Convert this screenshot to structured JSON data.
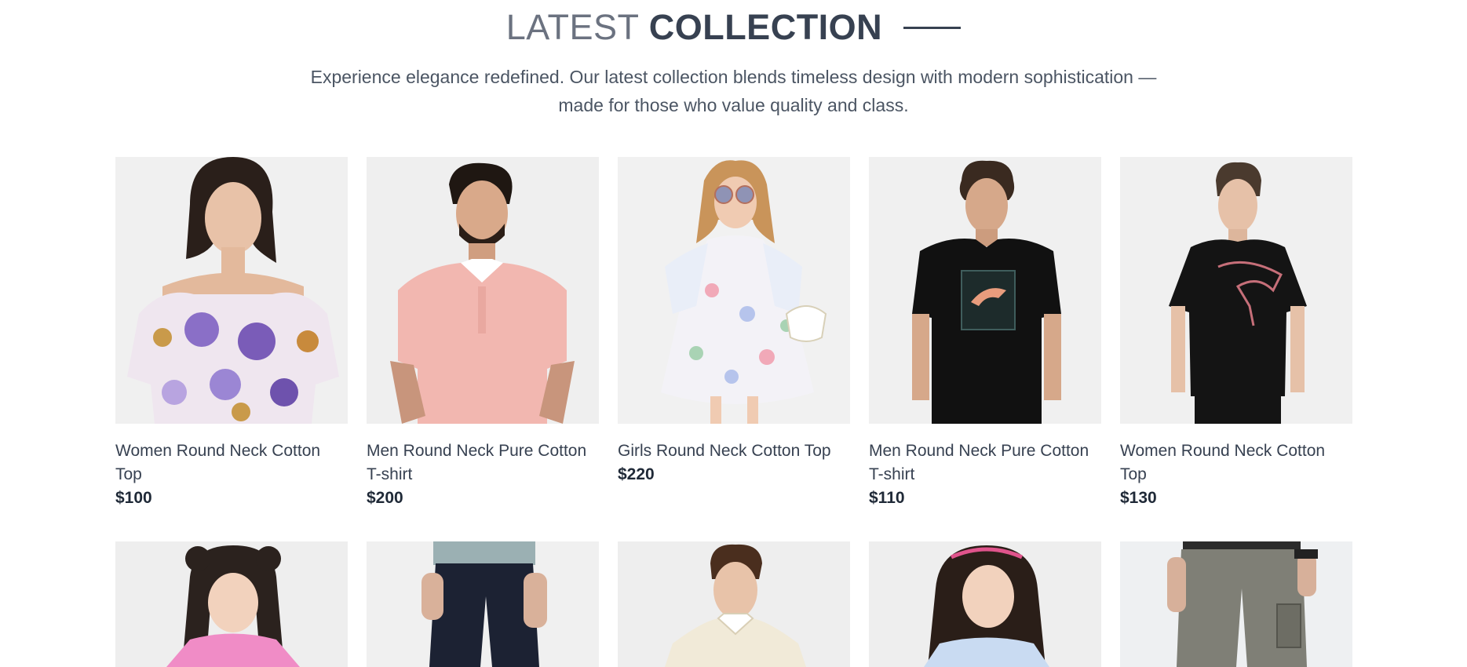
{
  "section": {
    "title_light": "LATEST",
    "title_bold": "COLLECTION",
    "subtitle_line1": "Experience elegance redefined. Our latest collection blends timeless design with modern sophistication —",
    "subtitle_line2": "made for those who value quality and class."
  },
  "products": [
    {
      "name": "Women Round Neck Cotton Top",
      "price": "$100",
      "image": "woman-floral-off-shoulder-top"
    },
    {
      "name": "Men Round Neck Pure Cotton T-shirt",
      "price": "$200",
      "image": "man-pink-polo-shirt"
    },
    {
      "name": "Girls Round Neck Cotton Top",
      "price": "$220",
      "image": "girl-floral-dress-sunglasses"
    },
    {
      "name": "Men Round Neck Pure Cotton T-shirt",
      "price": "$110",
      "image": "man-black-puma-tshirt"
    },
    {
      "name": "Women Round Neck Cotton Top",
      "price": "$130",
      "image": "woman-black-puma-tshirt"
    },
    {
      "image": "girl-pink-top"
    },
    {
      "image": "man-navy-pants"
    },
    {
      "image": "man-cream-polo"
    },
    {
      "image": "girl-light-blue-top"
    },
    {
      "image": "man-grey-cargo-pants"
    }
  ],
  "colors": {
    "pink_top": "#f2b7b0",
    "floral": "#8a6fc7",
    "black_tee": "#111111",
    "navy": "#1c2233",
    "cream": "#f1ead8",
    "light_blue": "#c9dbf2",
    "grey_cargo": "#7f7f76",
    "girl_pink": "#f08cc6"
  }
}
